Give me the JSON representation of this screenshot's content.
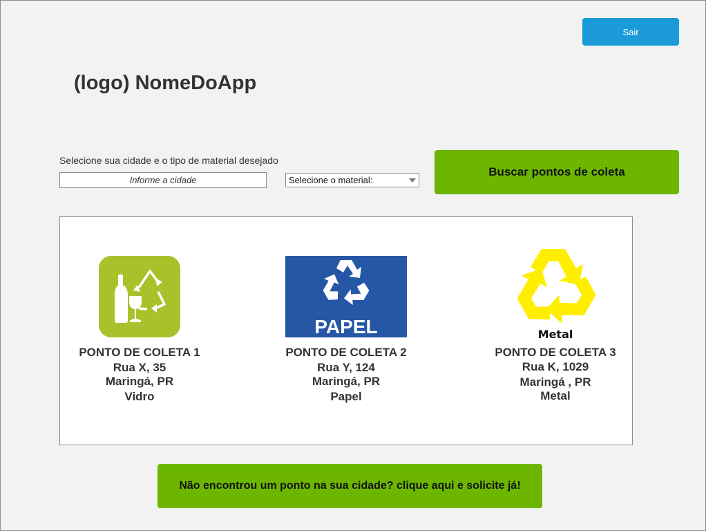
{
  "header": {
    "logout_label": "Sair",
    "app_title": "(logo) NomeDoApp"
  },
  "search": {
    "instructions": "Selecione sua cidade e o tipo de material desejado",
    "city_placeholder": "Informe a cidade",
    "city_value": "",
    "material_selected": "Selecione o material:",
    "search_button_label": "Buscar pontos de coleta"
  },
  "results": [
    {
      "title": "PONTO DE COLETA 1",
      "address": "Rua X, 35",
      "city": "Maringá, PR",
      "material": "Vidro",
      "icon": "glass-recycling-icon",
      "icon_color": "#a8c22c"
    },
    {
      "title": "PONTO DE COLETA 2",
      "address": "Rua Y, 124",
      "city": "Maringá, PR",
      "material": "Papel",
      "icon": "paper-recycling-icon",
      "icon_label": "PAPEL",
      "icon_color": "#2657a6"
    },
    {
      "title": "PONTO DE COLETA 3",
      "address": "Rua K, 1029",
      "city": "Maringá , PR",
      "material": "Metal",
      "icon": "metal-recycling-icon",
      "icon_label": "Metal",
      "icon_color": "#ffee00"
    }
  ],
  "footer": {
    "request_button_label": "Não encontrou um ponto na sua cidade? clique aqui e solicite já!"
  },
  "colors": {
    "logout_button": "#1a9bd8",
    "action_green": "#6db600",
    "background": "#f2f2f2"
  }
}
